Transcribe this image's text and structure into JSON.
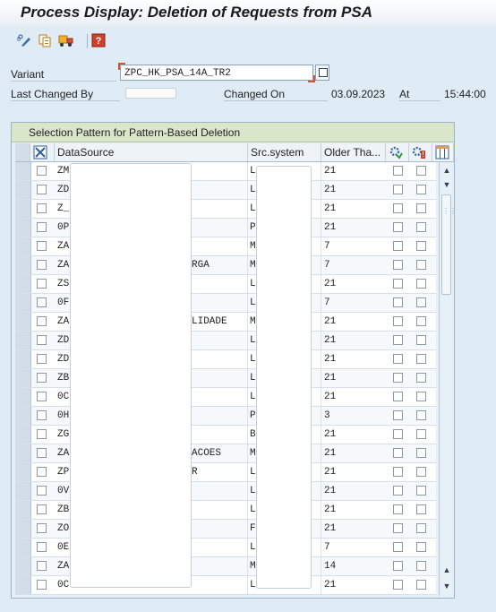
{
  "window": {
    "title": "Process Display: Deletion of Requests from PSA"
  },
  "toolbar": {
    "buttons": [
      {
        "name": "variant-icon"
      },
      {
        "name": "copy-icon"
      },
      {
        "name": "transport-icon"
      },
      {
        "name": "help-icon"
      }
    ]
  },
  "form": {
    "variant_label": "Variant",
    "variant_value": "ZPC_HK_PSA_14A_TR2",
    "last_changed_by_label": "Last Changed By",
    "last_changed_by_value": "",
    "changed_on_label": "Changed On",
    "changed_on_value": "03.09.2023",
    "at_label": "At",
    "at_value": "15:44:00"
  },
  "panel": {
    "title": "Selection Pattern for Pattern-Based Deletion"
  },
  "table": {
    "columns": {
      "datasource": "DataSource",
      "src_system": "Src.system",
      "older_than": "Older Tha..."
    },
    "rows": [
      {
        "ds": "ZM",
        "ds_tail": "",
        "src": "L",
        "older": "21"
      },
      {
        "ds": "ZD",
        "ds_tail": "",
        "src": "L",
        "older": "21"
      },
      {
        "ds": "Z_",
        "ds_tail": "",
        "src": "L",
        "older": "21"
      },
      {
        "ds": "0P",
        "ds_tail": "",
        "src": "P",
        "older": "21"
      },
      {
        "ds": "ZA",
        "ds_tail": "",
        "src": "M",
        "older": "7"
      },
      {
        "ds": "ZA",
        "ds_tail": "RGA",
        "src": "M",
        "older": "7"
      },
      {
        "ds": "ZS",
        "ds_tail": "",
        "src": "L",
        "older": "21"
      },
      {
        "ds": "0F",
        "ds_tail": "",
        "src": "L",
        "older": "7"
      },
      {
        "ds": "ZA",
        "ds_tail": "LIDADE",
        "src": "M",
        "older": "21"
      },
      {
        "ds": "ZD",
        "ds_tail": "",
        "src": "L",
        "older": "21"
      },
      {
        "ds": "ZD",
        "ds_tail": "",
        "src": "L",
        "older": "21"
      },
      {
        "ds": "ZB",
        "ds_tail": "",
        "src": "L",
        "older": "21"
      },
      {
        "ds": "0C",
        "ds_tail": "",
        "src": "L",
        "older": "21"
      },
      {
        "ds": "0H",
        "ds_tail": "",
        "src": "P",
        "older": "3"
      },
      {
        "ds": "ZG",
        "ds_tail": "",
        "src": "B",
        "older": "21"
      },
      {
        "ds": "ZA",
        "ds_tail": "ACOES",
        "src": "M",
        "older": "21"
      },
      {
        "ds": "ZP",
        "ds_tail": "R",
        "src": "L",
        "older": "21"
      },
      {
        "ds": "0V",
        "ds_tail": "",
        "src": "L",
        "older": "21"
      },
      {
        "ds": "ZB",
        "ds_tail": "",
        "src": "L",
        "older": "21"
      },
      {
        "ds": "ZO",
        "ds_tail": "",
        "src": "F",
        "older": "21"
      },
      {
        "ds": "0E",
        "ds_tail": "",
        "src": "L",
        "older": "7"
      },
      {
        "ds": "ZA",
        "ds_tail": "",
        "src": "M",
        "older": "14"
      },
      {
        "ds": "0C",
        "ds_tail": "",
        "src": "L",
        "older": "21"
      }
    ]
  },
  "colors": {
    "background": "#dfebf5",
    "panel_header": "#dae6c9",
    "grid_border": "#a9bccf"
  }
}
